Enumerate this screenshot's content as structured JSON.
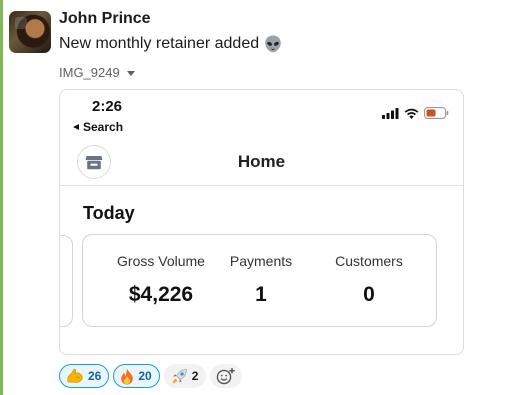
{
  "message": {
    "author": "John Prince",
    "text": "New monthly retainer added",
    "emoji": "alien-icon",
    "attachment_name": "IMG_9249"
  },
  "screenshot": {
    "status_time": "2:26",
    "back_label": "Search",
    "nav_title": "Home",
    "section_title": "Today",
    "stats": [
      {
        "label": "Gross Volume",
        "value": "$4,226"
      },
      {
        "label": "Payments",
        "value": "1"
      },
      {
        "label": "Customers",
        "value": "0"
      }
    ]
  },
  "reactions": [
    {
      "emoji": "flexed-biceps-icon",
      "count": "26",
      "active": true
    },
    {
      "emoji": "fire-icon",
      "count": "20",
      "active": true
    },
    {
      "emoji": "rocket-icon",
      "count": "2",
      "active": false
    }
  ],
  "colors": {
    "sidebar_accent": "#7fb95a",
    "reaction_active_border": "#1d9bd1",
    "reaction_active_text": "#1264a3"
  }
}
